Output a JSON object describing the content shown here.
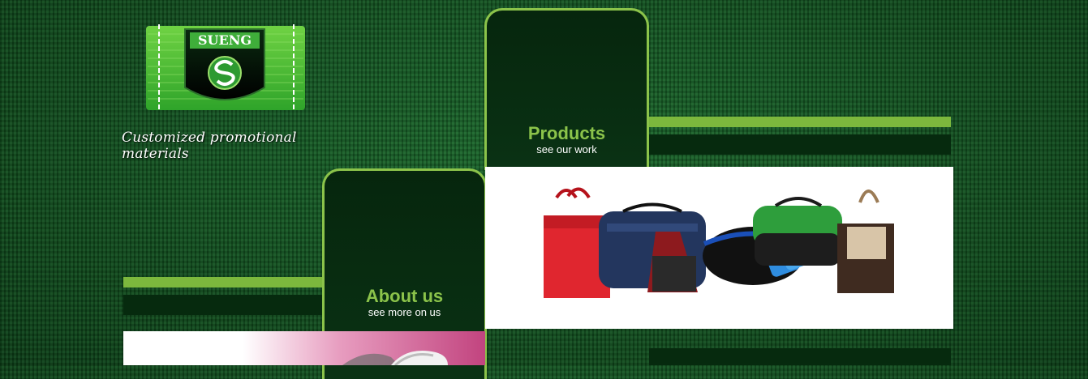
{
  "brand": {
    "name": "SUENG",
    "tagline": "Customized promotional materials"
  },
  "nav": {
    "products": {
      "title": "Products",
      "subtitle": "see our work"
    },
    "about": {
      "title": "About us",
      "subtitle": "see more on us"
    }
  },
  "colors": {
    "accent": "#8bc34a",
    "bar_green": "#7cb83d",
    "dark_green": "#062a0e",
    "background": "#0d4a1d"
  },
  "images": {
    "products_panel": "promotional-bags-photo",
    "about_panel": "pink-product-photo"
  }
}
